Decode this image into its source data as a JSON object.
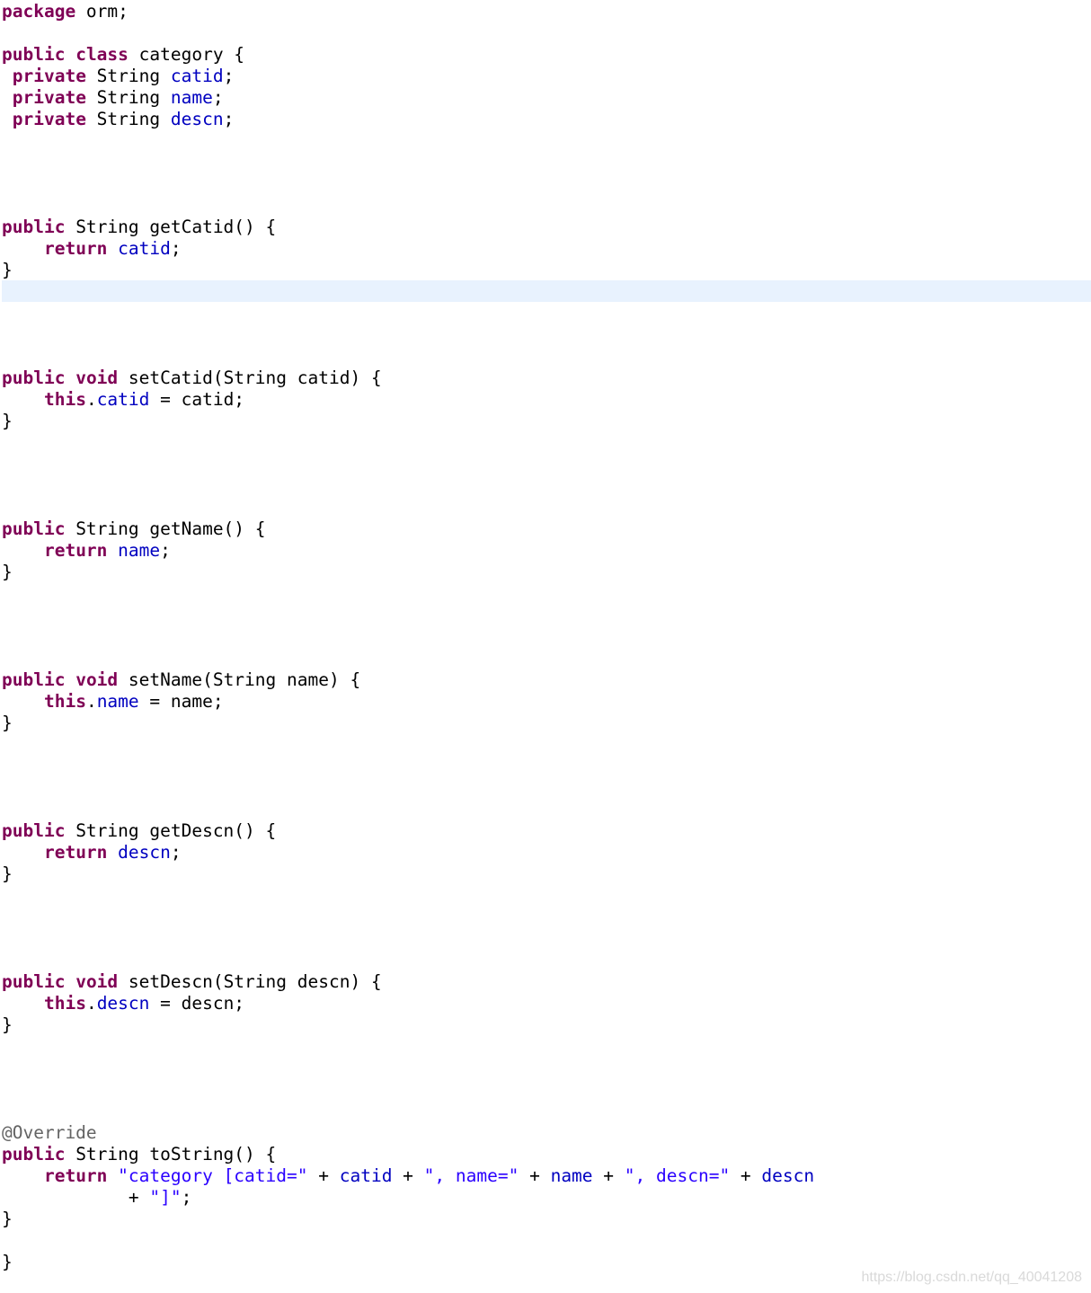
{
  "editor": {
    "lines": [
      {
        "tokens": [
          {
            "t": "package",
            "k": "kw"
          },
          {
            "t": " orm;",
            "k": "plain"
          }
        ]
      },
      {
        "tokens": []
      },
      {
        "tokens": [
          {
            "t": "public",
            "k": "kw"
          },
          {
            "t": " ",
            "k": "plain"
          },
          {
            "t": "class",
            "k": "kw"
          },
          {
            "t": " category {",
            "k": "plain"
          }
        ]
      },
      {
        "tokens": [
          {
            "t": " ",
            "k": "plain"
          },
          {
            "t": "private",
            "k": "kw"
          },
          {
            "t": " String ",
            "k": "plain"
          },
          {
            "t": "catid",
            "k": "field"
          },
          {
            "t": ";",
            "k": "plain"
          }
        ]
      },
      {
        "tokens": [
          {
            "t": " ",
            "k": "plain"
          },
          {
            "t": "private",
            "k": "kw"
          },
          {
            "t": " String ",
            "k": "plain"
          },
          {
            "t": "name",
            "k": "field"
          },
          {
            "t": ";",
            "k": "plain"
          }
        ]
      },
      {
        "tokens": [
          {
            "t": " ",
            "k": "plain"
          },
          {
            "t": "private",
            "k": "kw"
          },
          {
            "t": " String ",
            "k": "plain"
          },
          {
            "t": "descn",
            "k": "field"
          },
          {
            "t": ";",
            "k": "plain"
          }
        ]
      },
      {
        "tokens": []
      },
      {
        "tokens": []
      },
      {
        "tokens": []
      },
      {
        "tokens": []
      },
      {
        "tokens": [
          {
            "t": "public",
            "k": "kw"
          },
          {
            "t": " String getCatid() {",
            "k": "plain"
          }
        ]
      },
      {
        "tokens": [
          {
            "t": "    ",
            "k": "plain"
          },
          {
            "t": "return",
            "k": "kw"
          },
          {
            "t": " ",
            "k": "plain"
          },
          {
            "t": "catid",
            "k": "field"
          },
          {
            "t": ";",
            "k": "plain"
          }
        ]
      },
      {
        "tokens": [
          {
            "t": "}",
            "k": "plain"
          }
        ]
      },
      {
        "tokens": []
      },
      {
        "tokens": []
      },
      {
        "tokens": []
      },
      {
        "tokens": []
      },
      {
        "tokens": [
          {
            "t": "public",
            "k": "kw"
          },
          {
            "t": " ",
            "k": "plain"
          },
          {
            "t": "void",
            "k": "kw"
          },
          {
            "t": " setCatid(String catid) {",
            "k": "plain"
          }
        ]
      },
      {
        "tokens": [
          {
            "t": "    ",
            "k": "plain"
          },
          {
            "t": "this",
            "k": "kw"
          },
          {
            "t": ".",
            "k": "plain"
          },
          {
            "t": "catid",
            "k": "field"
          },
          {
            "t": " = catid;",
            "k": "plain"
          }
        ]
      },
      {
        "tokens": [
          {
            "t": "}",
            "k": "plain"
          }
        ]
      },
      {
        "tokens": []
      },
      {
        "tokens": []
      },
      {
        "tokens": []
      },
      {
        "tokens": []
      },
      {
        "tokens": [
          {
            "t": "public",
            "k": "kw"
          },
          {
            "t": " String getName() {",
            "k": "plain"
          }
        ]
      },
      {
        "tokens": [
          {
            "t": "    ",
            "k": "plain"
          },
          {
            "t": "return",
            "k": "kw"
          },
          {
            "t": " ",
            "k": "plain"
          },
          {
            "t": "name",
            "k": "field"
          },
          {
            "t": ";",
            "k": "plain"
          }
        ]
      },
      {
        "tokens": [
          {
            "t": "}",
            "k": "plain"
          }
        ]
      },
      {
        "tokens": []
      },
      {
        "tokens": []
      },
      {
        "tokens": []
      },
      {
        "tokens": []
      },
      {
        "tokens": [
          {
            "t": "public",
            "k": "kw"
          },
          {
            "t": " ",
            "k": "plain"
          },
          {
            "t": "void",
            "k": "kw"
          },
          {
            "t": " setName(String name) {",
            "k": "plain"
          }
        ]
      },
      {
        "tokens": [
          {
            "t": "    ",
            "k": "plain"
          },
          {
            "t": "this",
            "k": "kw"
          },
          {
            "t": ".",
            "k": "plain"
          },
          {
            "t": "name",
            "k": "field"
          },
          {
            "t": " = name;",
            "k": "plain"
          }
        ]
      },
      {
        "tokens": [
          {
            "t": "}",
            "k": "plain"
          }
        ]
      },
      {
        "tokens": []
      },
      {
        "tokens": []
      },
      {
        "tokens": []
      },
      {
        "tokens": []
      },
      {
        "tokens": [
          {
            "t": "public",
            "k": "kw"
          },
          {
            "t": " String getDescn() {",
            "k": "plain"
          }
        ]
      },
      {
        "tokens": [
          {
            "t": "    ",
            "k": "plain"
          },
          {
            "t": "return",
            "k": "kw"
          },
          {
            "t": " ",
            "k": "plain"
          },
          {
            "t": "descn",
            "k": "field"
          },
          {
            "t": ";",
            "k": "plain"
          }
        ]
      },
      {
        "tokens": [
          {
            "t": "}",
            "k": "plain"
          }
        ]
      },
      {
        "tokens": []
      },
      {
        "tokens": []
      },
      {
        "tokens": []
      },
      {
        "tokens": []
      },
      {
        "tokens": [
          {
            "t": "public",
            "k": "kw"
          },
          {
            "t": " ",
            "k": "plain"
          },
          {
            "t": "void",
            "k": "kw"
          },
          {
            "t": " setDescn(String descn) {",
            "k": "plain"
          }
        ]
      },
      {
        "tokens": [
          {
            "t": "    ",
            "k": "plain"
          },
          {
            "t": "this",
            "k": "kw"
          },
          {
            "t": ".",
            "k": "plain"
          },
          {
            "t": "descn",
            "k": "field"
          },
          {
            "t": " = descn;",
            "k": "plain"
          }
        ]
      },
      {
        "tokens": [
          {
            "t": "}",
            "k": "plain"
          }
        ]
      },
      {
        "tokens": []
      },
      {
        "tokens": []
      },
      {
        "tokens": []
      },
      {
        "tokens": []
      },
      {
        "tokens": [
          {
            "t": "@Override",
            "k": "ann"
          }
        ]
      },
      {
        "tokens": [
          {
            "t": "public",
            "k": "kw"
          },
          {
            "t": " String toString() {",
            "k": "plain"
          }
        ]
      },
      {
        "tokens": [
          {
            "t": "    ",
            "k": "plain"
          },
          {
            "t": "return",
            "k": "kw"
          },
          {
            "t": " ",
            "k": "plain"
          },
          {
            "t": "\"category [catid=\"",
            "k": "str"
          },
          {
            "t": " + ",
            "k": "plain"
          },
          {
            "t": "catid",
            "k": "field"
          },
          {
            "t": " + ",
            "k": "plain"
          },
          {
            "t": "\", name=\"",
            "k": "str"
          },
          {
            "t": " + ",
            "k": "plain"
          },
          {
            "t": "name",
            "k": "field"
          },
          {
            "t": " + ",
            "k": "plain"
          },
          {
            "t": "\", descn=\"",
            "k": "str"
          },
          {
            "t": " + ",
            "k": "plain"
          },
          {
            "t": "descn",
            "k": "field"
          }
        ]
      },
      {
        "tokens": [
          {
            "t": "            + ",
            "k": "plain"
          },
          {
            "t": "\"]\"",
            "k": "str"
          },
          {
            "t": ";",
            "k": "plain"
          }
        ]
      },
      {
        "tokens": [
          {
            "t": "}",
            "k": "plain"
          }
        ]
      },
      {
        "tokens": []
      },
      {
        "tokens": [
          {
            "t": "}",
            "k": "plain"
          }
        ]
      }
    ]
  },
  "watermark": "https://blog.csdn.net/qq_40041208",
  "colors": {
    "keyword": "#7f0055",
    "field": "#0000c0",
    "string": "#2a00ff",
    "annotation": "#646464",
    "current_line_highlight": "#e8f2fe"
  }
}
